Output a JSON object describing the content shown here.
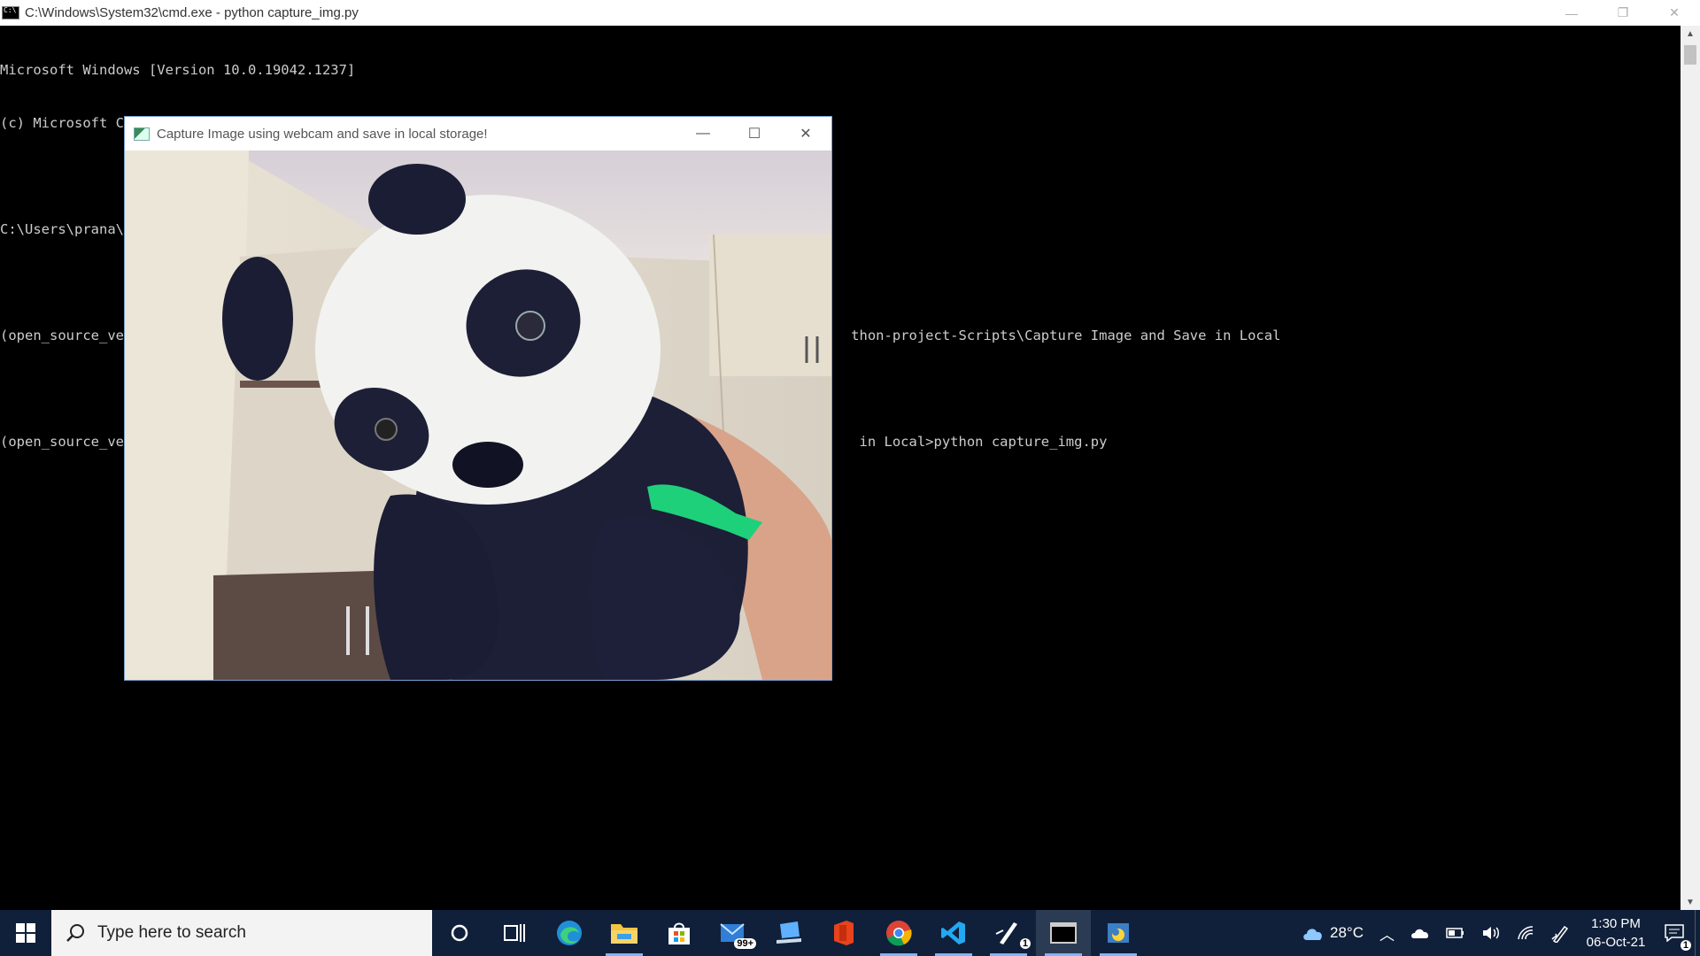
{
  "cmd": {
    "title": "C:\\Windows\\System32\\cmd.exe - python  capture_img.py",
    "lines": [
      "Microsoft Windows [Version 10.0.19042.1237]",
      "(c) Microsoft Corporation. All rights reserved.",
      "",
      "C:\\Users\\prana\\OneDrive\\Desktop\\web_dev>open_source_venv\\Scripts\\activate.bat",
      "",
      "(open_source_ven                                                                                       thon-project-Scripts\\Capture Image and Save in Local",
      "",
      "(open_source_ven                                                                                        in Local>python capture_img.py"
    ],
    "controls": {
      "minimize": "—",
      "restore": "❐",
      "close": "✕"
    }
  },
  "capture_window": {
    "title": "Capture Image using webcam and save in local storage!",
    "controls": {
      "minimize": "—",
      "maximize": "☐",
      "close": "✕"
    },
    "image_description_icon": "webcam-frame"
  },
  "taskbar": {
    "search_placeholder": "Type here to search",
    "mail_badge": "99+",
    "pen_badge": "1",
    "weather": "28°C",
    "time": "1:30 PM",
    "date": "06-Oct-21",
    "notification_badge": "1",
    "colors": {
      "taskbar_bg": "#10203a",
      "active_indicator": "#7fb4ff"
    }
  }
}
